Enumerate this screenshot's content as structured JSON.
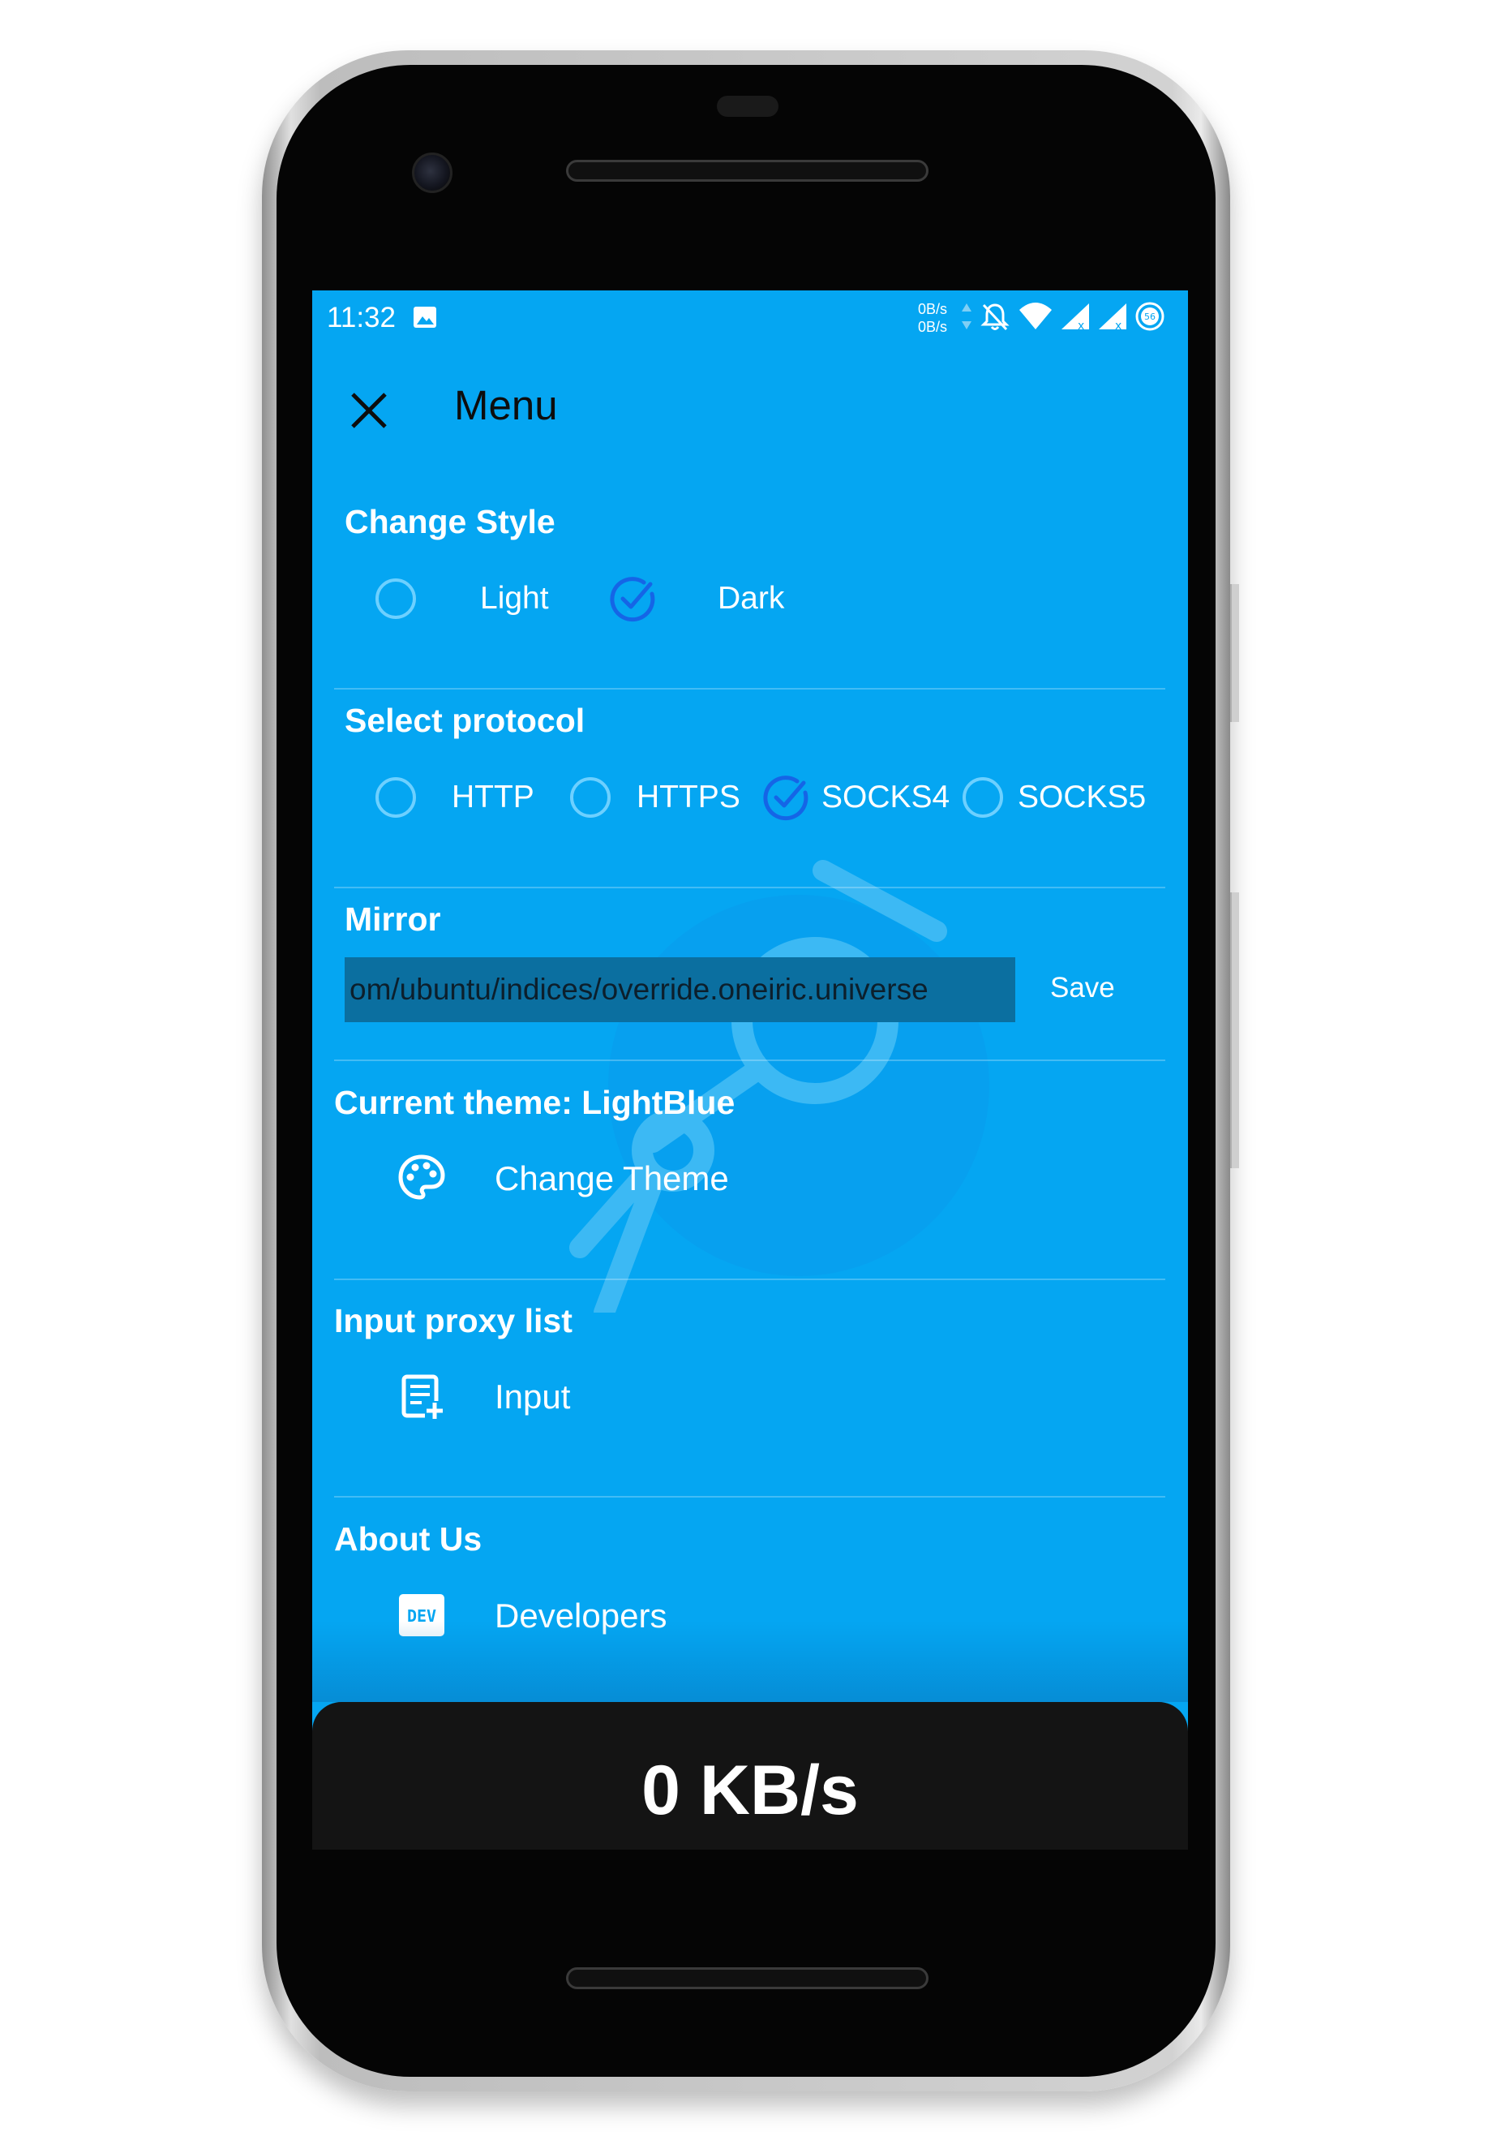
{
  "status_bar": {
    "time": "11:32",
    "net_up": "0B/s",
    "net_down": "0B/s",
    "battery_badge": "56",
    "icons": [
      "image-icon",
      "data-arrows-icon",
      "notifications-off-icon",
      "wifi-icon",
      "signal-icon",
      "signal-icon",
      "battery-icon"
    ]
  },
  "top_bar": {
    "title": "Menu",
    "close_icon": "close-icon"
  },
  "sections": {
    "change_style": {
      "title": "Change Style",
      "options": [
        {
          "label": "Light",
          "selected": false
        },
        {
          "label": "Dark",
          "selected": true
        }
      ]
    },
    "select_protocol": {
      "title": "Select protocol",
      "options": [
        {
          "label": "HTTP",
          "selected": false
        },
        {
          "label": "HTTPS",
          "selected": false
        },
        {
          "label": "SOCKS4",
          "selected": true
        },
        {
          "label": "SOCKS5",
          "selected": false
        }
      ]
    },
    "mirror": {
      "title": "Mirror",
      "value": "om/ubuntu/indices/override.oneiric.universe",
      "save_label": "Save"
    },
    "theme": {
      "title": "Current theme: LightBlue",
      "action_label": "Change Theme",
      "icon": "palette-icon"
    },
    "proxy_list": {
      "title": "Input proxy list",
      "action_label": "Input",
      "icon": "note-add-icon"
    },
    "about": {
      "title": "About Us",
      "action_label": "Developers",
      "icon": "dev-logo-icon",
      "icon_text": "DEV"
    }
  },
  "speed": {
    "value": "0 KB/s"
  },
  "colors": {
    "screen_bg": "#05a6f2",
    "accent_check": "#1565e6",
    "radio_ring": "#6dd0ff",
    "mirror_field": "#0b6fa0",
    "speed_panel": "#141414"
  }
}
